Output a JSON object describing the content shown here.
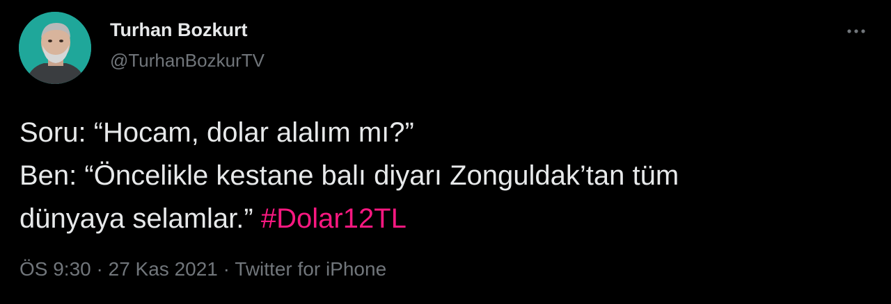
{
  "author": {
    "display_name": "Turhan Bozkurt",
    "handle": "@TurhanBozkurTV"
  },
  "tweet": {
    "line1": "Soru: “Hocam, dolar alalım mı?”",
    "line2": "Ben: “Öncelikle kestane balı diyarı Zonguldak’tan tüm",
    "line3_text": "dünyaya selamlar.”",
    "hashtag": "#Dolar12TL"
  },
  "meta": {
    "time": "ÖS 9:30",
    "separator": "·",
    "date": "27 Kas 2021",
    "source": "Twitter for iPhone"
  },
  "icons": {
    "avatar": "profile-photo",
    "more": "more-horizontal-icon"
  },
  "colors": {
    "background": "#000000",
    "primary_text": "#e7e9ea",
    "secondary_text": "#71767b",
    "hashtag": "#f91880",
    "avatar_bg": "#1fa79a"
  }
}
